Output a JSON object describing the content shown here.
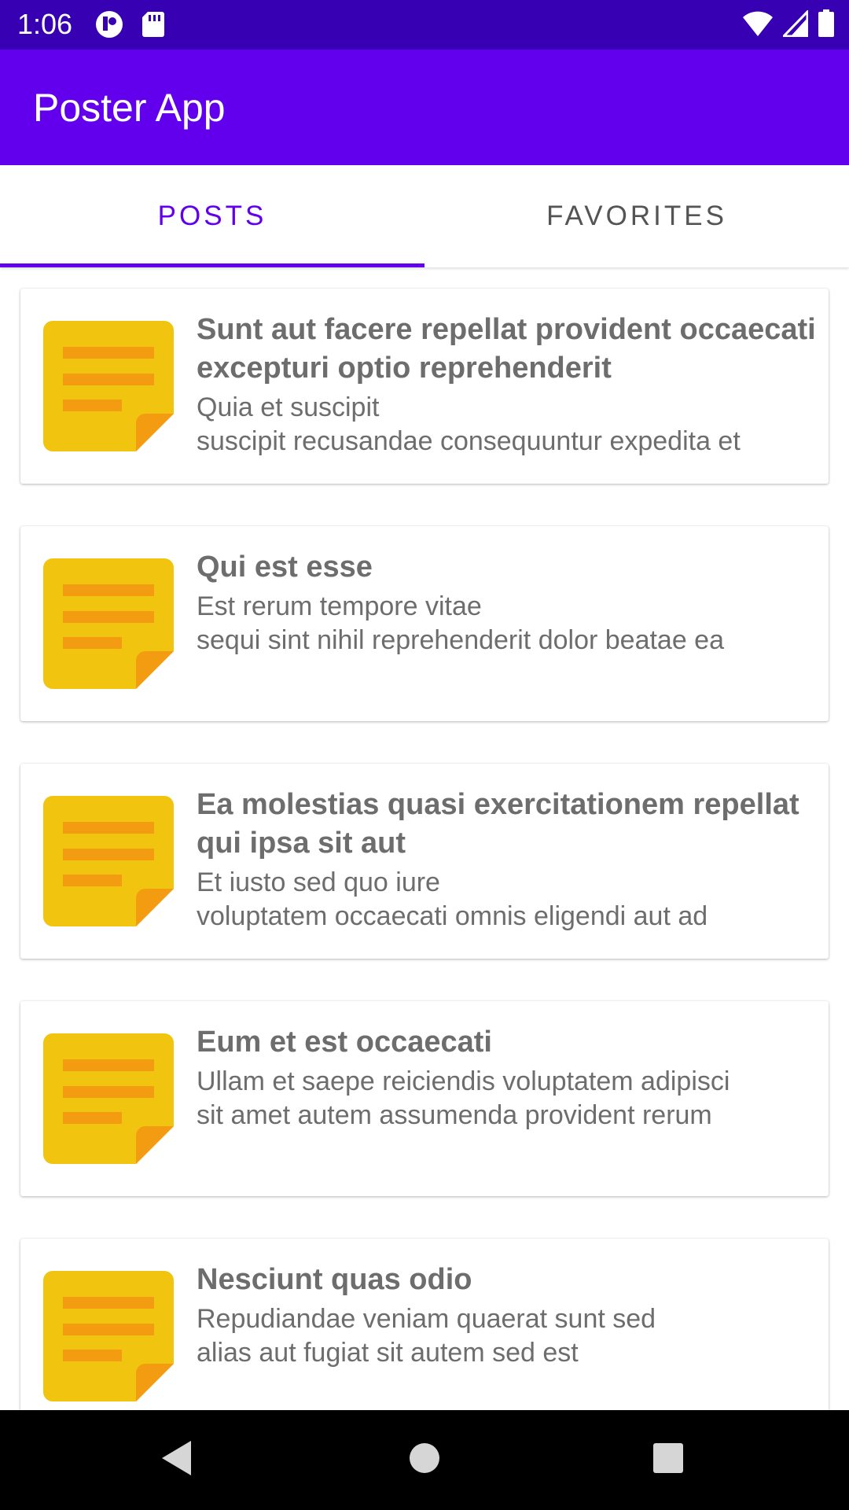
{
  "status_bar": {
    "time": "1:06",
    "icons": [
      "notification-app-icon",
      "sd-card-icon",
      "wifi-icon",
      "signal-icon",
      "battery-icon"
    ]
  },
  "app_bar": {
    "title": "Poster App",
    "color": "#6200ee"
  },
  "tabs": [
    {
      "label": "POSTS",
      "selected": true
    },
    {
      "label": "FAVORITES",
      "selected": false
    }
  ],
  "posts": [
    {
      "title": "Sunt aut facere repellat provident occaecati excepturi optio reprehenderit",
      "body": "Quia et suscipit\nsuscipit recusandae consequuntur expedita et",
      "icon": "note-icon"
    },
    {
      "title": "Qui est esse",
      "body": "Est rerum tempore vitae\nsequi sint nihil reprehenderit dolor beatae ea",
      "icon": "note-icon"
    },
    {
      "title": "Ea molestias quasi exercitationem repellat qui ipsa sit aut",
      "body": "Et iusto sed quo iure\nvoluptatem occaecati omnis eligendi aut ad",
      "icon": "note-icon"
    },
    {
      "title": "Eum et est occaecati",
      "body": "Ullam et saepe reiciendis voluptatem adipisci\nsit amet autem assumenda provident rerum",
      "icon": "note-icon"
    },
    {
      "title": "Nesciunt quas odio",
      "body": "Repudiandae veniam quaerat sunt sed\nalias aut fugiat sit autem sed est",
      "icon": "note-icon"
    }
  ],
  "nav_bar": {
    "buttons": [
      "back-icon",
      "home-icon",
      "recents-icon"
    ]
  },
  "colors": {
    "status_bar": "#3700b3",
    "primary": "#6200ee",
    "note_yellow": "#f1c40f",
    "note_orange": "#f39c12",
    "text_gray": "#6d6d6d"
  }
}
